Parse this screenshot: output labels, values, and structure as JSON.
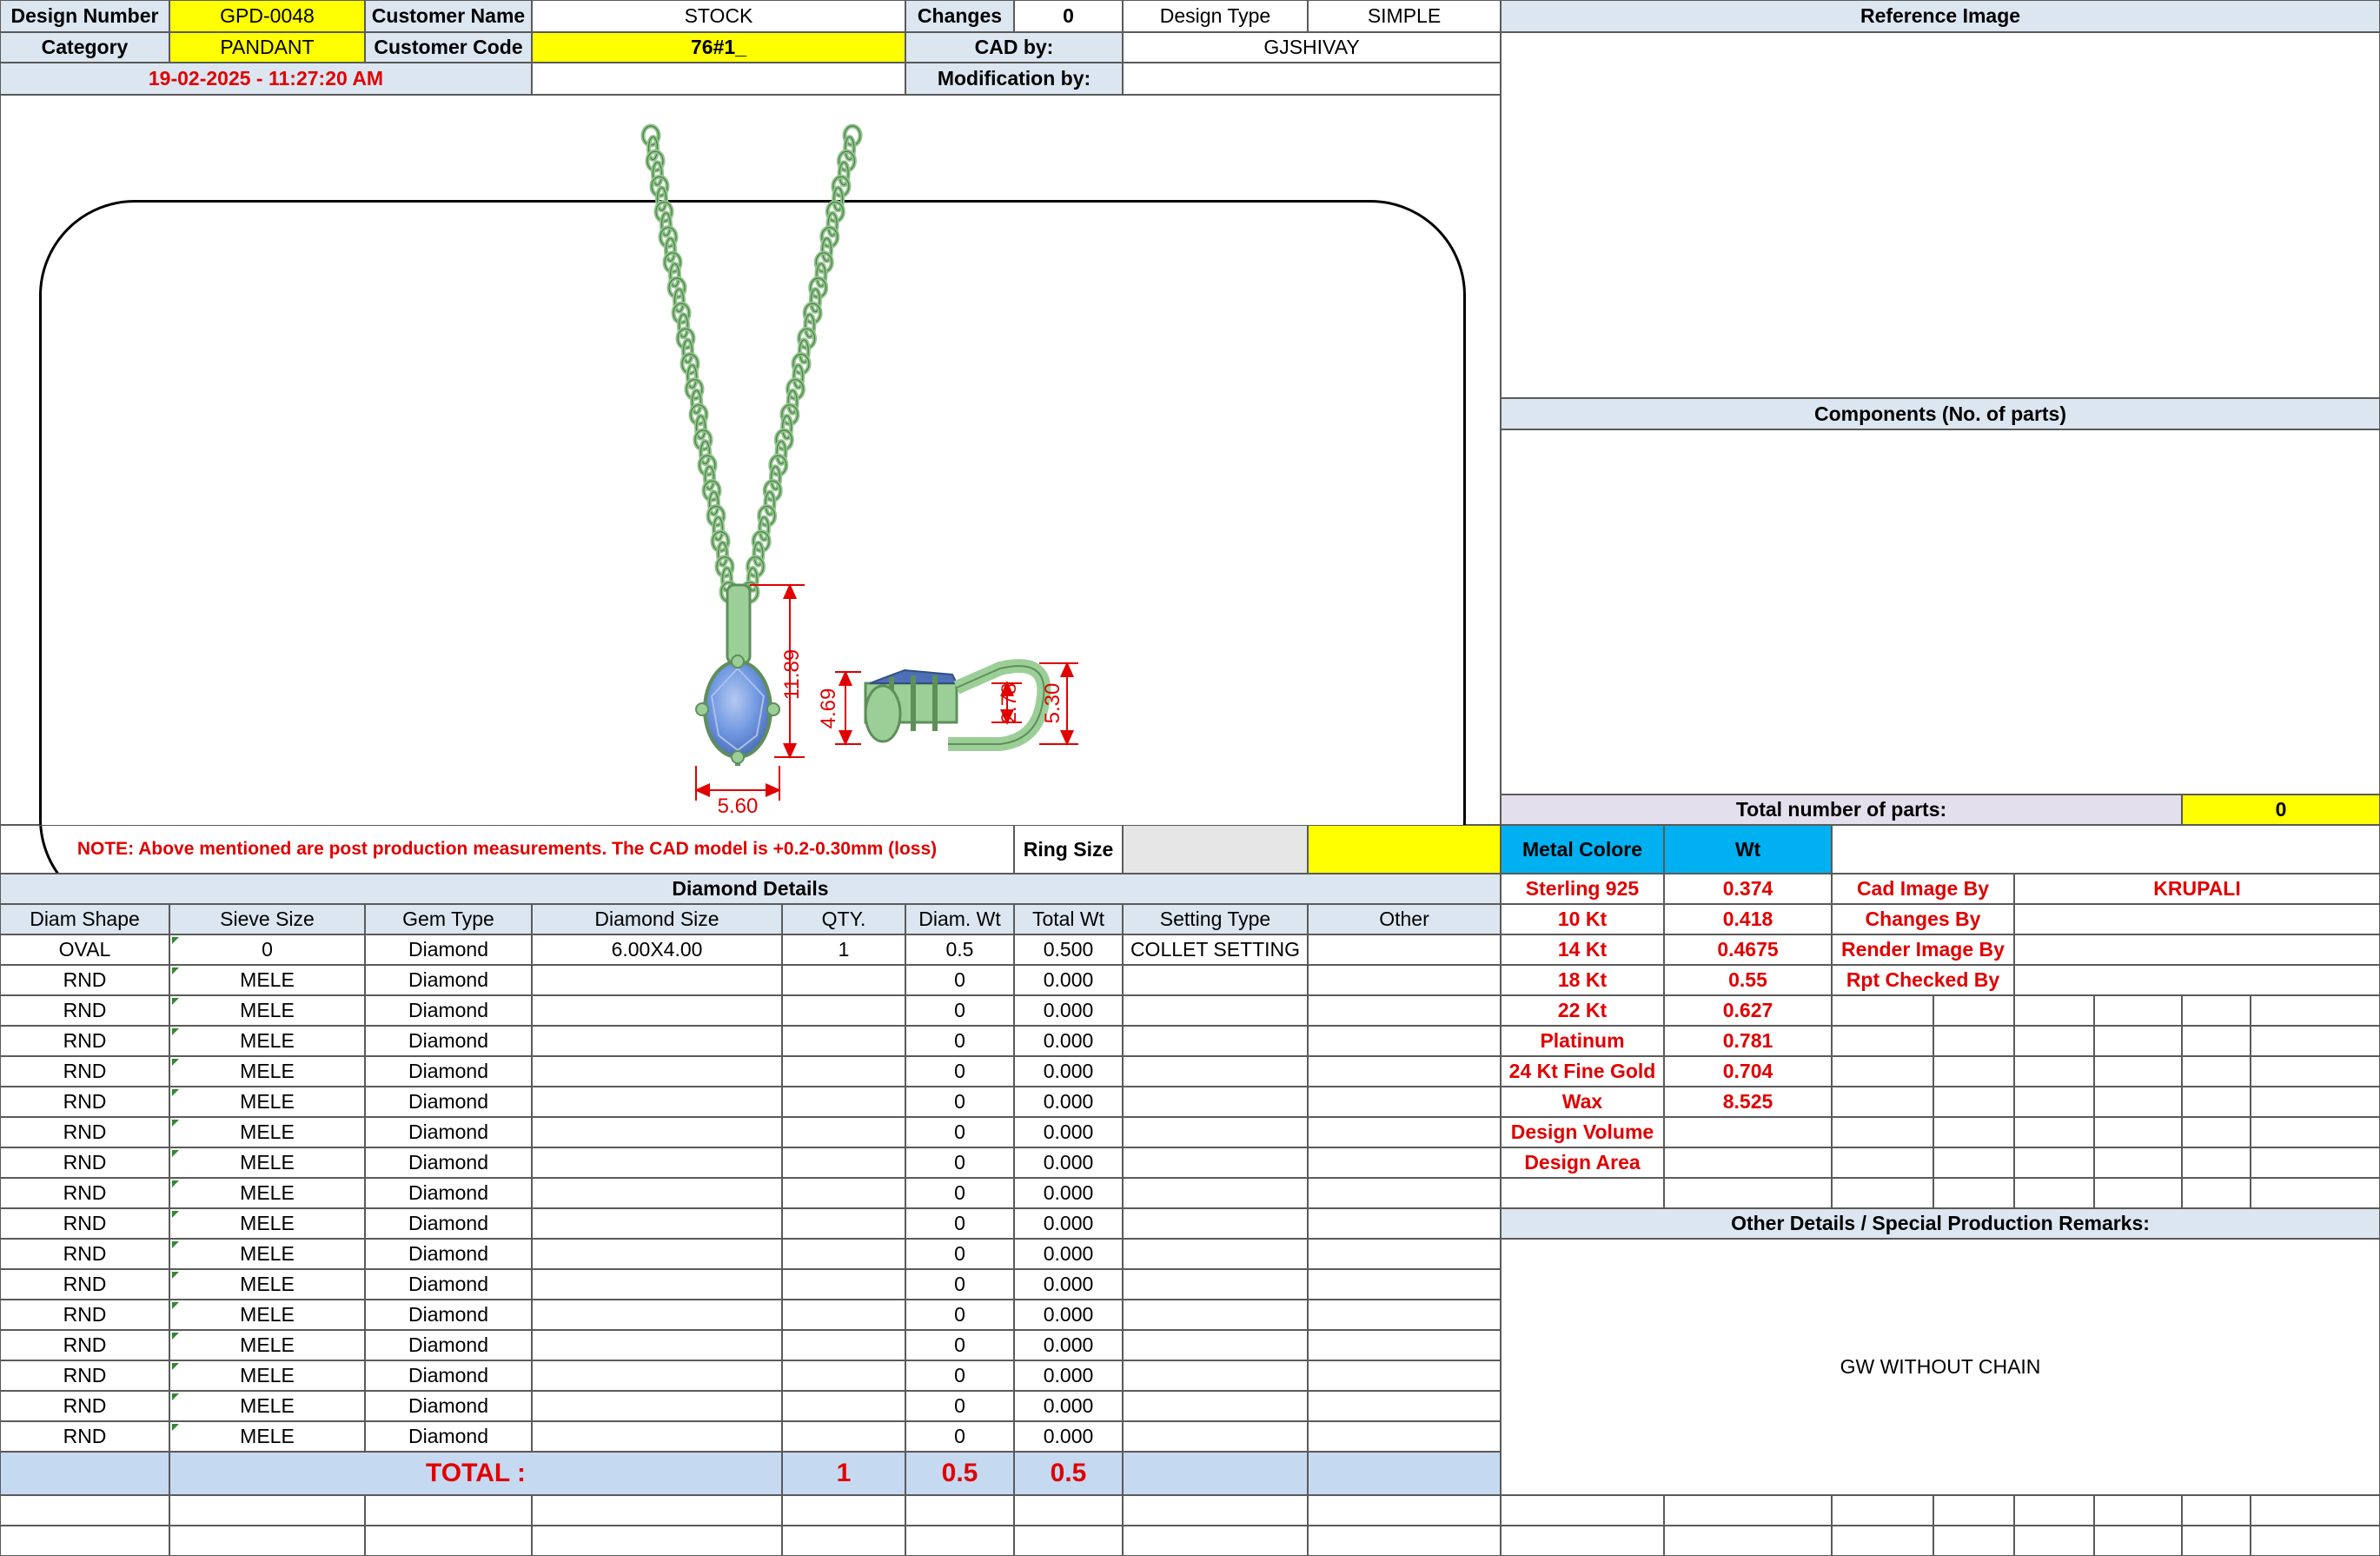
{
  "header": {
    "design_number_label": "Design Number",
    "design_number": "GPD-0048",
    "customer_name_label": "Customer Name",
    "customer_name": "STOCK",
    "changes_label": "Changes",
    "changes": "0",
    "design_type_label": "Design Type",
    "design_type": "SIMPLE",
    "category_label": "Category",
    "category": "PANDANT",
    "customer_code_label": "Customer Code",
    "customer_code": "76#1_",
    "cad_by_label": "CAD by:",
    "cad_by": "GJSHIVAY",
    "timestamp": "19-02-2025 - 11:27:20 AM",
    "modification_by_label": "Modification by:",
    "modification_by": ""
  },
  "dimensions": {
    "height_front": "11.89",
    "width_front": "5.60",
    "side_outer": "4.69",
    "side_inner": "2.78",
    "side_height": "5.30"
  },
  "note": "NOTE: Above mentioned are post production measurements. The CAD model is +0.2-0.30mm (loss)",
  "ring_size_label": "Ring Size",
  "ring_size": "",
  "reference_image_label": "Reference Image",
  "components_label": "Components (No. of parts)",
  "total_parts_label": "Total number of parts:",
  "total_parts": "0",
  "diamond": {
    "title": "Diamond Details",
    "columns": [
      "Diam Shape",
      "Sieve Size",
      "Gem Type",
      "Diamond Size",
      "QTY.",
      "Diam. Wt",
      "Total Wt",
      "Setting Type",
      "Other"
    ],
    "rows": [
      [
        "OVAL",
        "0",
        "Diamond",
        "6.00X4.00",
        "1",
        "0.5",
        "0.500",
        "COLLET SETTING",
        ""
      ],
      [
        "RND",
        "MELE",
        "Diamond",
        "",
        "",
        "0",
        "0.000",
        "",
        ""
      ],
      [
        "RND",
        "MELE",
        "Diamond",
        "",
        "",
        "0",
        "0.000",
        "",
        ""
      ],
      [
        "RND",
        "MELE",
        "Diamond",
        "",
        "",
        "0",
        "0.000",
        "",
        ""
      ],
      [
        "RND",
        "MELE",
        "Diamond",
        "",
        "",
        "0",
        "0.000",
        "",
        ""
      ],
      [
        "RND",
        "MELE",
        "Diamond",
        "",
        "",
        "0",
        "0.000",
        "",
        ""
      ],
      [
        "RND",
        "MELE",
        "Diamond",
        "",
        "",
        "0",
        "0.000",
        "",
        ""
      ],
      [
        "RND",
        "MELE",
        "Diamond",
        "",
        "",
        "0",
        "0.000",
        "",
        ""
      ],
      [
        "RND",
        "MELE",
        "Diamond",
        "",
        "",
        "0",
        "0.000",
        "",
        ""
      ],
      [
        "RND",
        "MELE",
        "Diamond",
        "",
        "",
        "0",
        "0.000",
        "",
        ""
      ],
      [
        "RND",
        "MELE",
        "Diamond",
        "",
        "",
        "0",
        "0.000",
        "",
        ""
      ],
      [
        "RND",
        "MELE",
        "Diamond",
        "",
        "",
        "0",
        "0.000",
        "",
        ""
      ],
      [
        "RND",
        "MELE",
        "Diamond",
        "",
        "",
        "0",
        "0.000",
        "",
        ""
      ],
      [
        "RND",
        "MELE",
        "Diamond",
        "",
        "",
        "0",
        "0.000",
        "",
        ""
      ],
      [
        "RND",
        "MELE",
        "Diamond",
        "",
        "",
        "0",
        "0.000",
        "",
        ""
      ],
      [
        "RND",
        "MELE",
        "Diamond",
        "",
        "",
        "0",
        "0.000",
        "",
        ""
      ],
      [
        "RND",
        "MELE",
        "Diamond",
        "",
        "",
        "0",
        "0.000",
        "",
        ""
      ]
    ],
    "total_label": "TOTAL :",
    "total_qty": "1",
    "total_diam_wt": "0.5",
    "total_wt": "0.5"
  },
  "metal": {
    "header_label": "Metal Colore",
    "wt_label": "Wt",
    "items": [
      {
        "name": "Sterling 925",
        "wt": "0.374"
      },
      {
        "name": "10 Kt",
        "wt": "0.418"
      },
      {
        "name": "14 Kt",
        "wt": "0.4675"
      },
      {
        "name": "18 Kt",
        "wt": "0.55"
      },
      {
        "name": "22 Kt",
        "wt": "0.627"
      },
      {
        "name": "Platinum",
        "wt": "0.781"
      },
      {
        "name": "24 Kt Fine Gold",
        "wt": "0.704"
      },
      {
        "name": "Wax",
        "wt": "8.525"
      },
      {
        "name": "Design Volume",
        "wt": ""
      },
      {
        "name": "Design Area",
        "wt": ""
      }
    ]
  },
  "credits": [
    {
      "label": "Cad Image By",
      "value": "KRUPALI"
    },
    {
      "label": "Changes By",
      "value": ""
    },
    {
      "label": "Render Image By",
      "value": ""
    },
    {
      "label": "Rpt Checked By",
      "value": ""
    }
  ],
  "other_details_label": "Other Details / Special Production Remarks:",
  "remarks": "GW WITHOUT CHAIN",
  "colors": {
    "header_blue": "#dce6f1",
    "highlight_yellow": "#ffff00",
    "metal_blue": "#00b0f0",
    "red_text": "#e00000",
    "metal_green": "#9ccf98",
    "gem_blue": "#6f97e0"
  }
}
